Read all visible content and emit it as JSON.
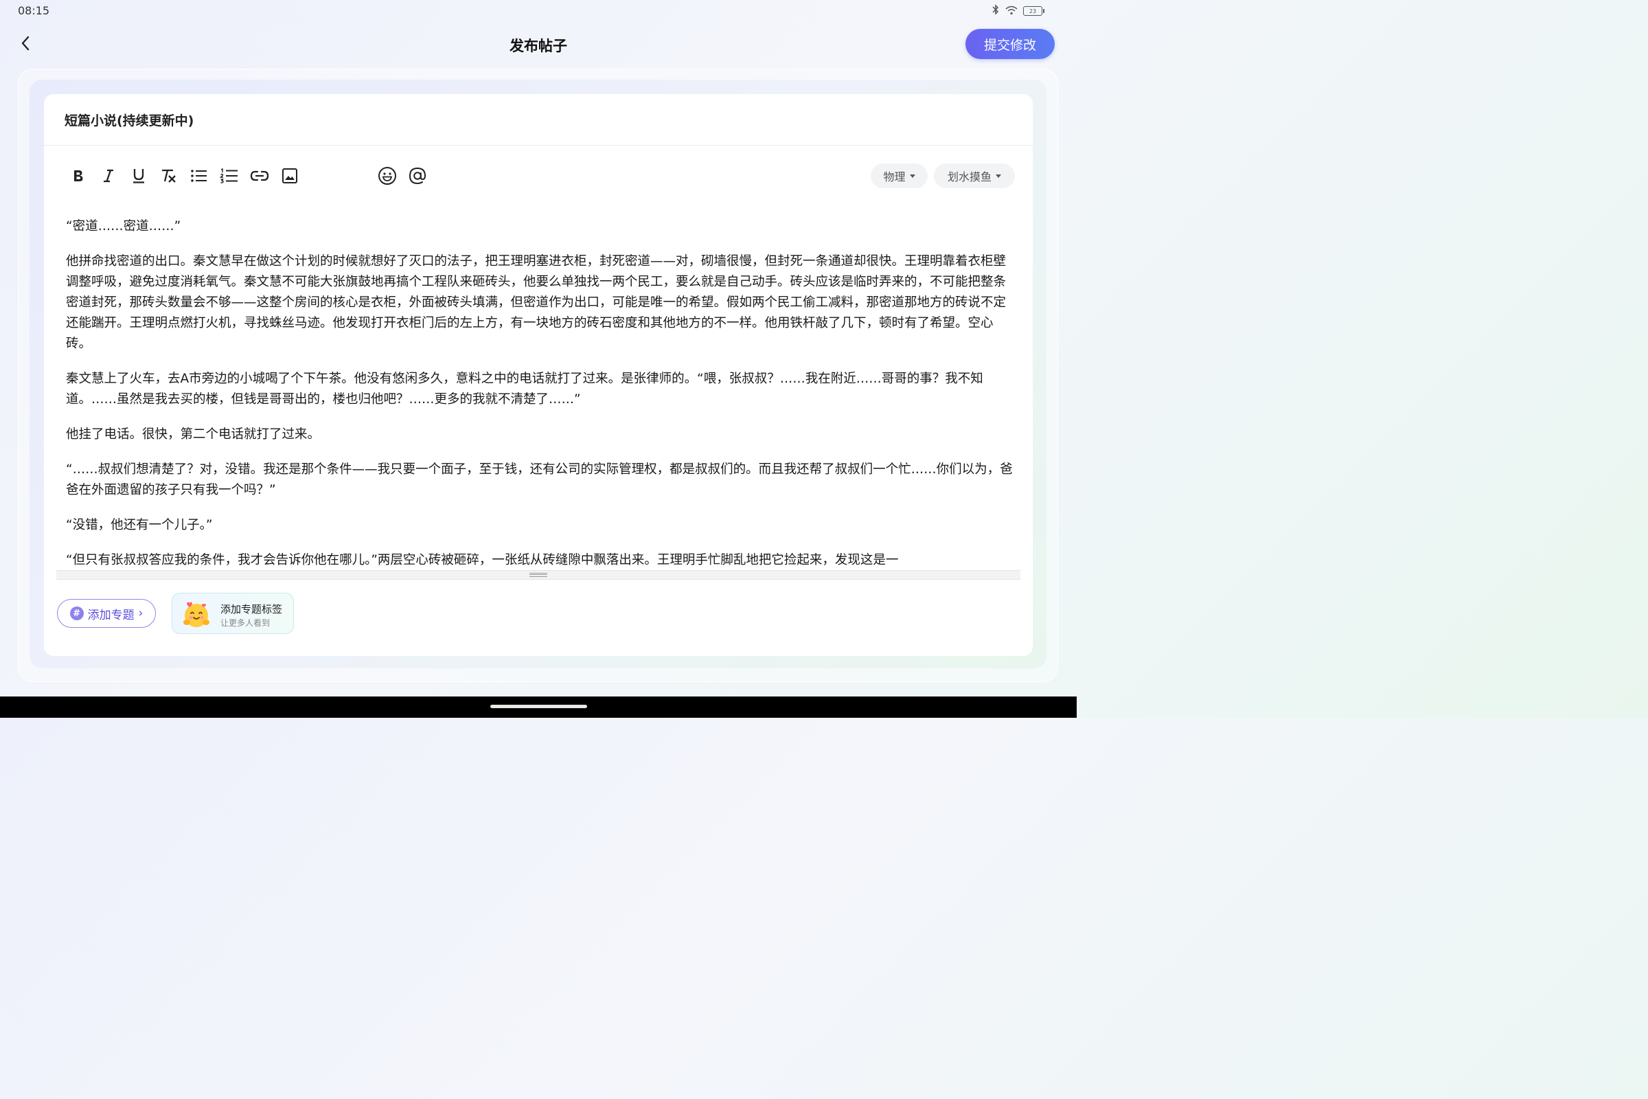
{
  "status_bar": {
    "time": "08:15",
    "battery": "23"
  },
  "header": {
    "title": "发布帖子",
    "submit_label": "提交修改"
  },
  "post": {
    "title": "短篇小说(持续更新中)",
    "paragraphs": [
      "“密道……密道……”",
      "他拼命找密道的出口。秦文慧早在做这个计划的时候就想好了灭口的法子，把王理明塞进衣柜，封死密道——对，砌墙很慢，但封死一条通道却很快。王理明靠着衣柜壁调整呼吸，避免过度消耗氧气。秦文慧不可能大张旗鼓地再搞个工程队来砸砖头，他要么单独找一两个民工，要么就是自己动手。砖头应该是临时弄来的，不可能把整条密道封死，那砖头数量会不够——这整个房间的核心是衣柜，外面被砖头填满，但密道作为出口，可能是唯一的希望。假如两个民工偷工减料，那密道那地方的砖说不定还能踹开。王理明点燃打火机，寻找蛛丝马迹。他发现打开衣柜门后的左上方，有一块地方的砖石密度和其他地方的不一样。他用铁杆敲了几下，顿时有了希望。空心砖。",
      "秦文慧上了火车，去A市旁边的小城喝了个下午茶。他没有悠闲多久，意料之中的电话就打了过来。是张律师的。“喂，张叔叔？……我在附近……哥哥的事？我不知道。……虽然是我去买的楼，但钱是哥哥出的，楼也归他吧？……更多的我就不清楚了……”",
      "他挂了电话。很快，第二个电话就打了过来。",
      "“……叔叔们想清楚了？对，没错。我还是那个条件——我只要一个面子，至于钱，还有公司的实际管理权，都是叔叔们的。而且我还帮了叔叔们一个忙……你们以为，爸爸在外面遗留的孩子只有我一个吗？”",
      "“没错，他还有一个儿子。”",
      "“但只有张叔叔答应我的条件，我才会告诉你他在哪儿。”两层空心砖被砸碎，一张纸从砖缝隙中飘落出来。王理明手忙脚乱地把它捡起来，发现这是一"
    ]
  },
  "toolbar": {
    "tools": [
      "bold-icon",
      "italic-icon",
      "underline-icon",
      "clear-format-icon",
      "bulleted-list-icon",
      "numbered-list-icon",
      "link-icon",
      "image-icon",
      "emoji-icon",
      "mention-icon"
    ]
  },
  "categories": {
    "primary": "物理",
    "secondary": "划水摸鱼"
  },
  "topic": {
    "add_label": "添加专题",
    "hash_symbol": "#",
    "chevron": "›",
    "tip_title": "添加专题标签",
    "tip_subtitle": "让更多人看到"
  },
  "colors": {
    "accent": "#6a63f0",
    "topic_border": "#8f86ee"
  }
}
